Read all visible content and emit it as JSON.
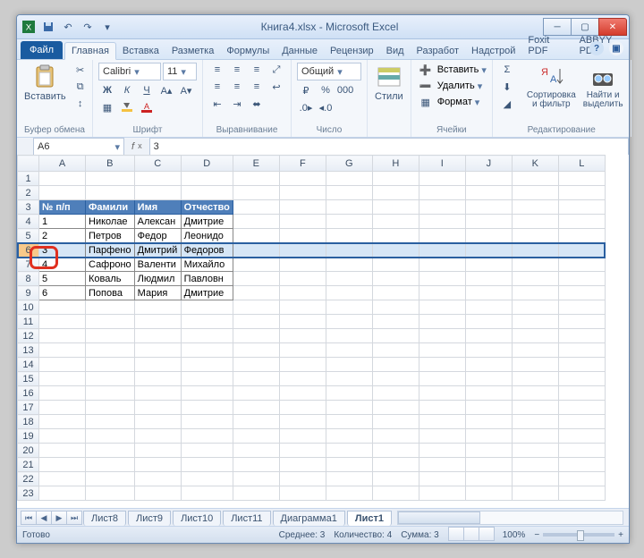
{
  "title": "Книга4.xlsx - Microsoft Excel",
  "filetab": "Файл",
  "tabs": [
    "Главная",
    "Вставка",
    "Разметка",
    "Формулы",
    "Данные",
    "Рецензир",
    "Вид",
    "Разработ",
    "Надстрой",
    "Foxit PDF",
    "ABBYY PD"
  ],
  "active_tab_index": 0,
  "ribbon": {
    "clipboard": {
      "paste": "Вставить",
      "label": "Буфер обмена"
    },
    "font": {
      "name": "Calibri",
      "size": "11",
      "label": "Шрифт"
    },
    "align_label": "Выравнивание",
    "number": {
      "format": "Общий",
      "label": "Число"
    },
    "styles_label": "Стили",
    "cells": {
      "insert": "Вставить",
      "delete": "Удалить",
      "format": "Формат",
      "label": "Ячейки"
    },
    "editing": {
      "sort": "Сортировка и фильтр",
      "find": "Найти и выделить",
      "label": "Редактирование"
    }
  },
  "namebox": "A6",
  "formula": "3",
  "columns": [
    "A",
    "B",
    "C",
    "D",
    "E",
    "F",
    "G",
    "H",
    "I",
    "J",
    "K",
    "L"
  ],
  "row_labels": [
    "1",
    "2",
    "3",
    "4",
    "5",
    "6",
    "7",
    "8",
    "9",
    "10",
    "11",
    "12",
    "13",
    "14",
    "15",
    "16",
    "17",
    "18",
    "19",
    "20",
    "21",
    "22",
    "23"
  ],
  "headers": [
    "№ п/п",
    "Фамили",
    "Имя",
    "Отчество"
  ],
  "rows": [
    [
      "1",
      "Николае",
      "Алексан",
      "Дмитрие"
    ],
    [
      "2",
      "Петров",
      "Федор",
      "Леонидо"
    ],
    [
      "3",
      "Парфено",
      "Дмитрий",
      "Федоров"
    ],
    [
      "4",
      "Сафроно",
      "Валенти",
      "Михайло"
    ],
    [
      "5",
      "Коваль",
      "Людмил",
      "Павловн"
    ],
    [
      "6",
      "Попова",
      "Мария",
      "Дмитрие"
    ]
  ],
  "selected_row_index": 2,
  "sheet_tabs": [
    "Лист8",
    "Лист9",
    "Лист10",
    "Лист11",
    "Диаграмма1",
    "Лист1"
  ],
  "active_sheet_index": 5,
  "status": {
    "ready": "Готово",
    "avg": "Среднее: 3",
    "count": "Количество: 4",
    "sum": "Сумма: 3",
    "zoom": "100%"
  }
}
